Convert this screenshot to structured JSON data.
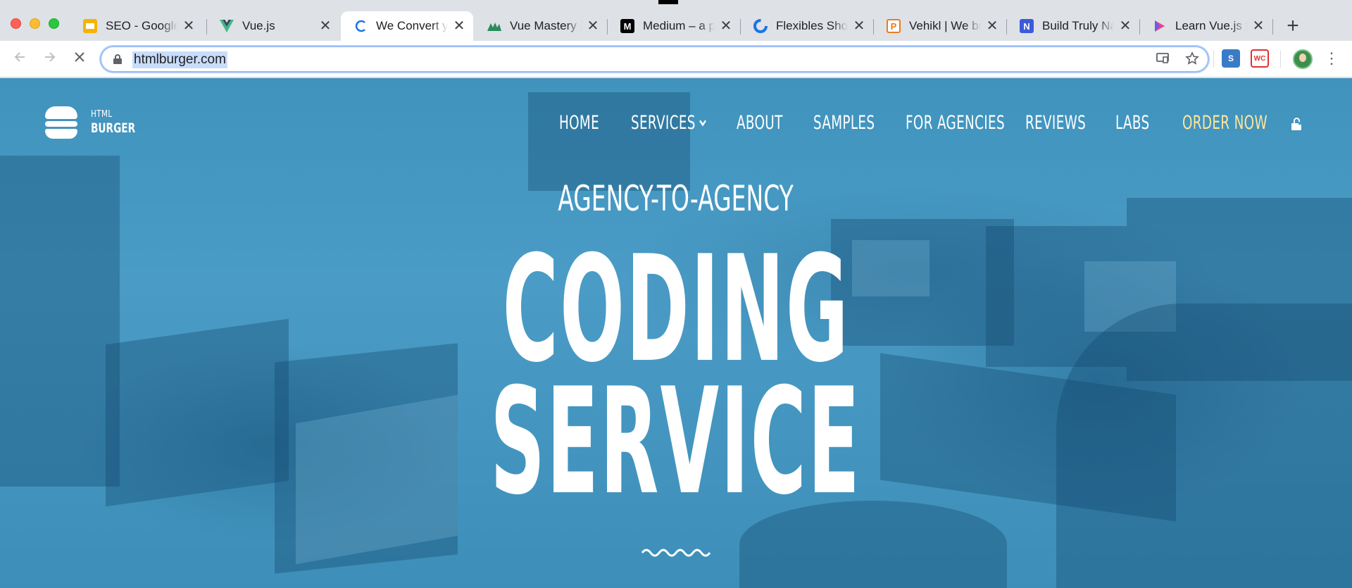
{
  "browser": {
    "tabs": [
      {
        "title": "SEO - Google",
        "favicon": "google-slides-icon",
        "color": "#f4b400",
        "active": false
      },
      {
        "title": "Vue.js",
        "favicon": "vue-icon",
        "color": "#41b883",
        "active": false
      },
      {
        "title": "We Convert y",
        "favicon": "loading-spinner-icon",
        "color": "#1a73e8",
        "active": true
      },
      {
        "title": "Vue Mastery |",
        "favicon": "vue-mastery-icon",
        "color": "#2c8a5a",
        "active": false
      },
      {
        "title": "Medium – a pl",
        "favicon": "medium-icon",
        "color": "#000000",
        "active": false
      },
      {
        "title": "Flexibles Shop",
        "favicon": "flexibles-icon",
        "color": "#1a73e8",
        "active": false
      },
      {
        "title": "Vehikl | We bu",
        "favicon": "vehikl-icon",
        "color": "#e67e22",
        "active": false
      },
      {
        "title": "Build Truly Na",
        "favicon": "nativescript-icon",
        "color": "#3b5bdb",
        "active": false
      },
      {
        "title": "Learn Vue.js f",
        "favicon": "learn-vue-icon",
        "color": "#e84393",
        "active": false
      }
    ],
    "address": {
      "url": "htmlburger.com"
    },
    "new_tab_label": "+",
    "close_glyph": "✕",
    "reload_state": "stop"
  },
  "site": {
    "logo": {
      "line1": "HTML",
      "line2": "BURGER"
    },
    "nav": [
      {
        "label": "HOME",
        "has_dropdown": false
      },
      {
        "label": "SERVICES",
        "has_dropdown": true
      },
      {
        "label": "ABOUT",
        "has_dropdown": false
      },
      {
        "label": "SAMPLES",
        "has_dropdown": false
      },
      {
        "label": "FOR AGENCIES",
        "has_dropdown": false
      },
      {
        "label": "REVIEWS",
        "has_dropdown": false
      },
      {
        "label": "LABS",
        "has_dropdown": false
      },
      {
        "label": "ORDER NOW",
        "has_dropdown": false
      }
    ],
    "hero": {
      "kicker": "AGENCY-TO-AGENCY",
      "headline_line1": "CODING",
      "headline_line2": "SERVICE"
    },
    "colors": {
      "hero_blue": "#4a9cc6",
      "order_now": "#ffe69a",
      "text": "#ffffff"
    }
  }
}
